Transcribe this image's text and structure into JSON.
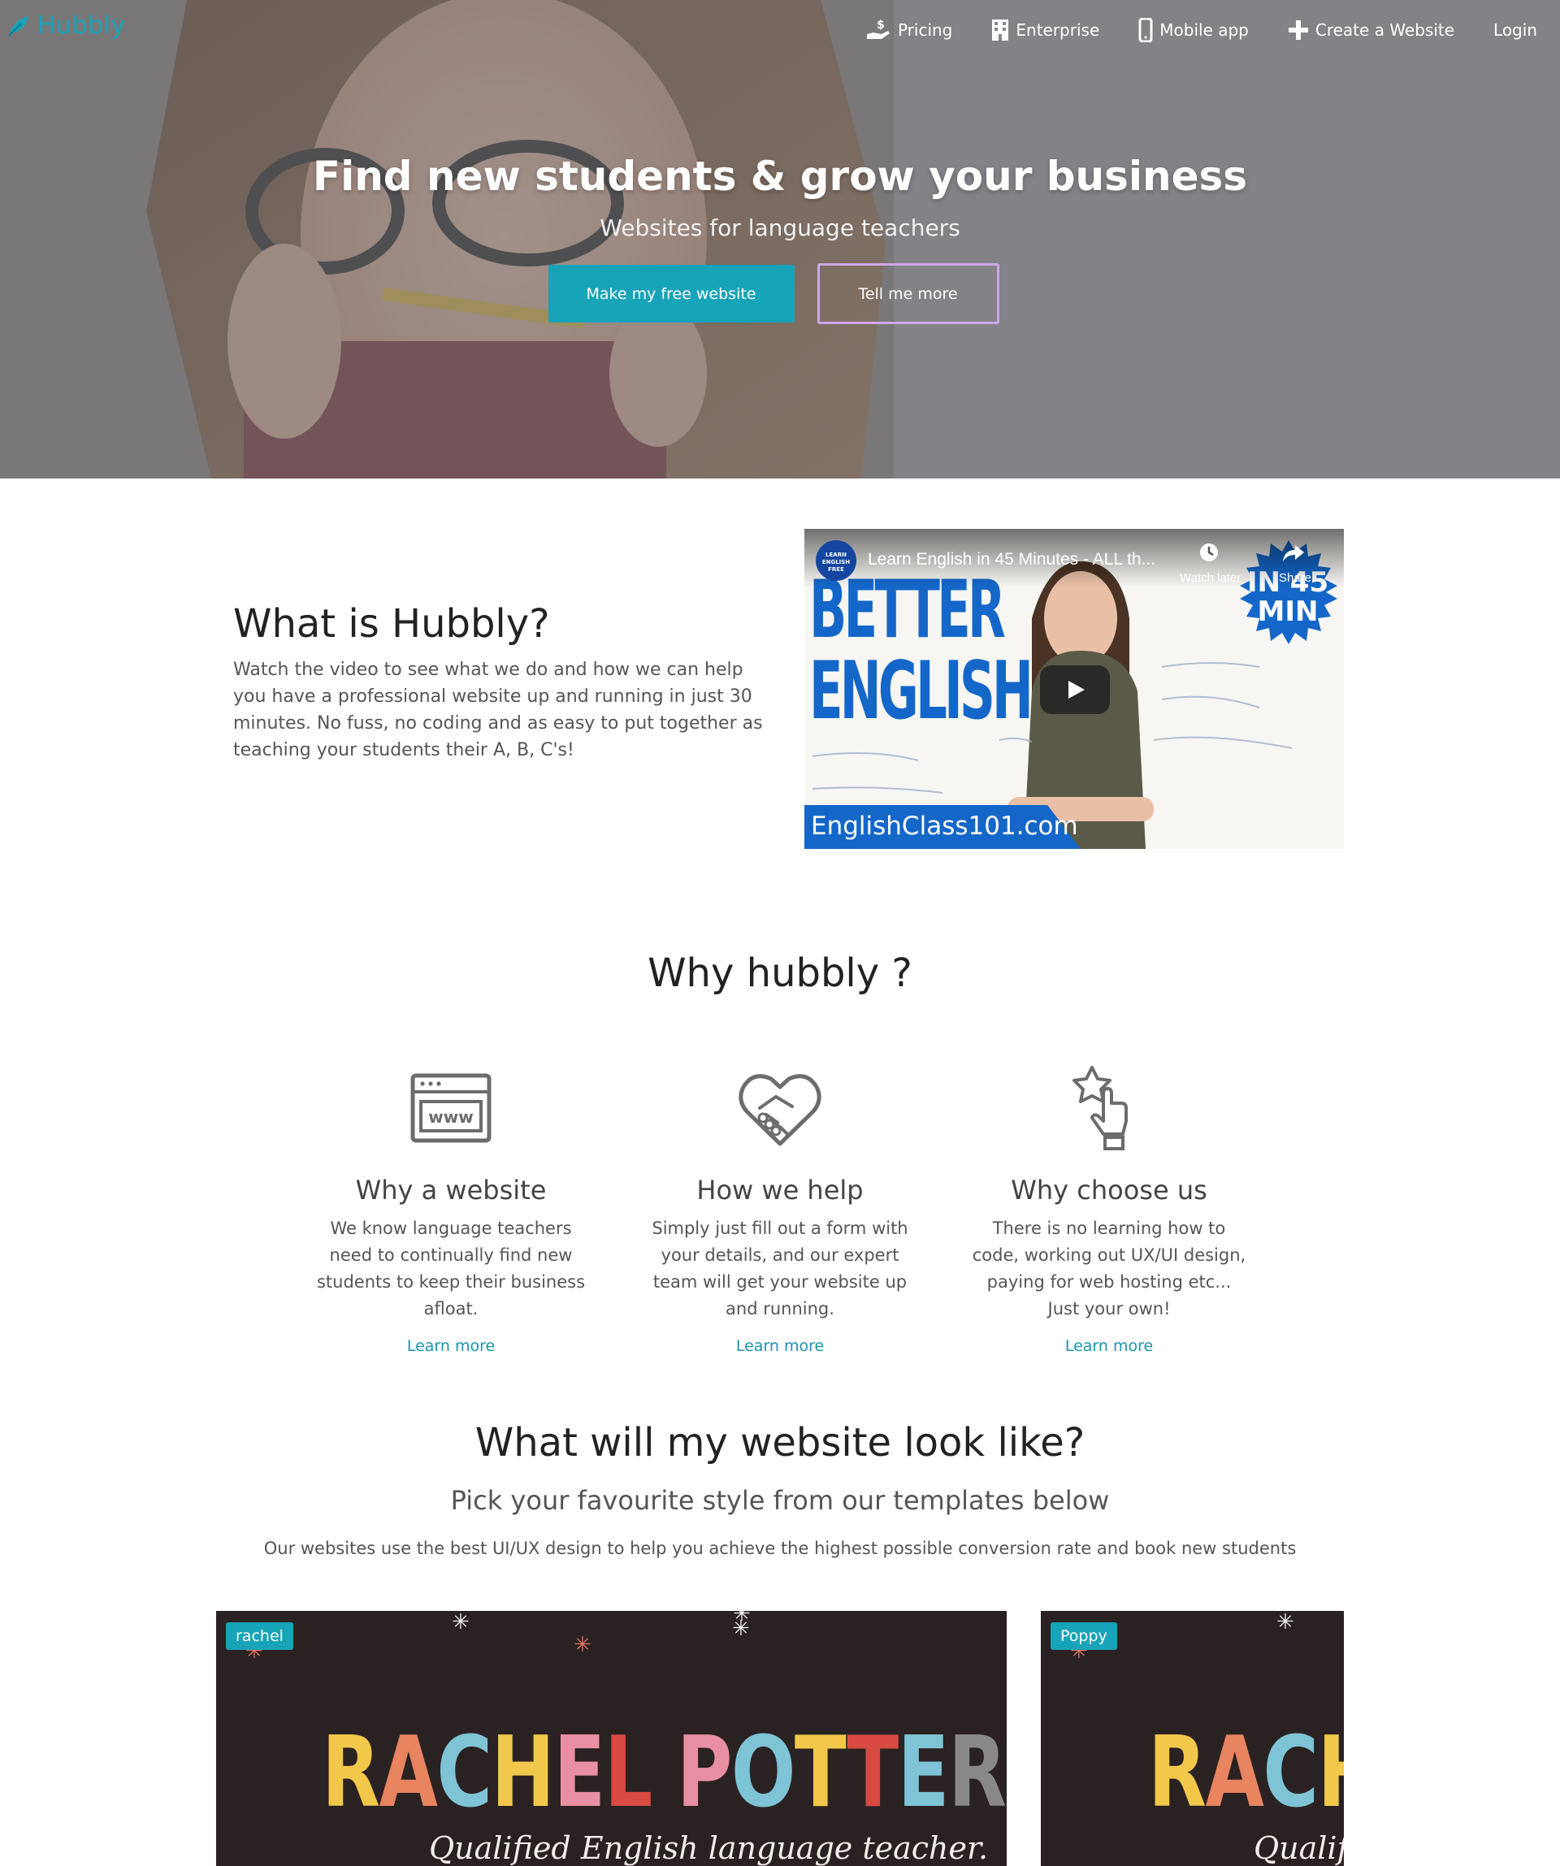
{
  "brand": {
    "name": "Hubbly",
    "color": "#17a3b8"
  },
  "nav": {
    "items": [
      {
        "label": "Pricing",
        "icon": "pricing-hand-icon"
      },
      {
        "label": "Enterprise",
        "icon": "building-icon"
      },
      {
        "label": "Mobile app",
        "icon": "mobile-phone-icon"
      },
      {
        "label": "Create a Website",
        "icon": "plus-icon"
      },
      {
        "label": "Login",
        "icon": ""
      }
    ]
  },
  "hero": {
    "title": "Find new students & grow your business",
    "subtitle": "Websites for language teachers",
    "primary_button": "Make my free website",
    "secondary_button": "Tell me more"
  },
  "about": {
    "title": "What is Hubbly?",
    "text": "Watch the video to see what we do and how we can help you have a professional website up and running in just 30 minutes. No fuss, no coding and as easy to put together as teaching your students their A, B, C's!",
    "video": {
      "title": "Learn English in 45 Minutes - ALL th...",
      "channel_badge": "LEARN ENGLISH FREE",
      "watch_later": "Watch later",
      "share": "Share",
      "thumb_line1": "BETTER",
      "thumb_line2": "ENGLISH",
      "badge_line1": "IN 45",
      "badge_line2": "MIN",
      "site": "EnglishClass101.com"
    }
  },
  "why": {
    "title": "Why hubbly ?",
    "features": [
      {
        "icon": "browser-www-icon",
        "title": "Why a website",
        "text": "We know language teachers need to continually find new students to keep their business afloat.",
        "link": "Learn more"
      },
      {
        "icon": "handshake-heart-icon",
        "title": "How we help",
        "text": "Simply just fill out a form with your details, and our expert team will get your website up and running.",
        "link": "Learn more"
      },
      {
        "icon": "star-pointer-icon",
        "title": "Why choose us",
        "text": "There is no learning how to code, working out UX/UI design, paying for web hosting etc... Just your own!",
        "link": "Learn more"
      }
    ]
  },
  "templates": {
    "title": "What will my website look like?",
    "subtitle": "Pick your favourite style from our templates below",
    "description": "Our websites use the best UI/UX design to help you achieve the highest possible conversion rate and book new students",
    "cards": [
      {
        "label": "rachel",
        "name_part1": "RACHEL",
        "name_part2": "POTTER",
        "tagline": "Qualified English language teacher."
      },
      {
        "label": "Poppy",
        "name_part1": "RACH",
        "name_part2": "",
        "tagline": "Qualif"
      }
    ]
  }
}
